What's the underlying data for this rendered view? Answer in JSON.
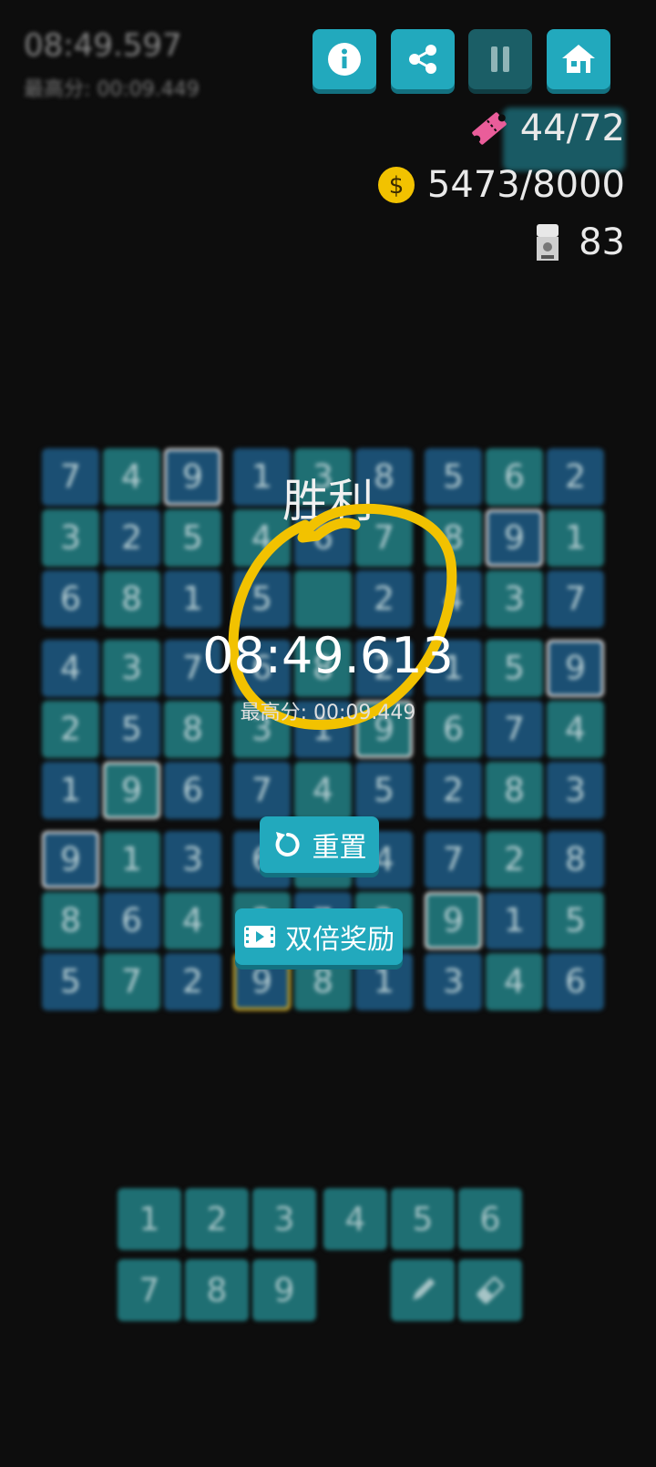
{
  "header": {
    "timer": "08:49.597",
    "best_score": "最高分: 00:09.449"
  },
  "stats": {
    "tickets": "44/72",
    "coins": "5473/8000",
    "gacha": "83"
  },
  "board": {
    "rows": [
      [
        "7",
        "4",
        "9",
        "1",
        "3",
        "8",
        "5",
        "6",
        "2"
      ],
      [
        "3",
        "2",
        "5",
        "4",
        "6",
        "7",
        "8",
        "9",
        "1"
      ],
      [
        "6",
        "8",
        "1",
        "5",
        "",
        "2",
        "4",
        "3",
        "7"
      ],
      [
        "4",
        "3",
        "7",
        "6",
        "8",
        "2",
        "1",
        "5",
        "9"
      ],
      [
        "2",
        "5",
        "8",
        "3",
        "1",
        "9",
        "6",
        "7",
        "4"
      ],
      [
        "1",
        "9",
        "6",
        "7",
        "4",
        "5",
        "2",
        "8",
        "3"
      ],
      [
        "9",
        "1",
        "3",
        "6",
        "5",
        "4",
        "7",
        "2",
        "8"
      ],
      [
        "8",
        "6",
        "4",
        "2",
        "7",
        "3",
        "9",
        "1",
        "5"
      ],
      [
        "5",
        "7",
        "2",
        "9",
        "8",
        "1",
        "3",
        "4",
        "6"
      ]
    ]
  },
  "win": {
    "title": "胜利",
    "time": "08:49.613",
    "best": "最高分:  00:09.449",
    "reset_label": "重置",
    "double_label": "双倍奖励"
  },
  "keypad": {
    "keys": [
      "1",
      "2",
      "3",
      "4",
      "5",
      "6",
      "7",
      "8",
      "9"
    ]
  },
  "colors": {
    "accent": "#22a9bd",
    "highlight": "#f2c200"
  }
}
